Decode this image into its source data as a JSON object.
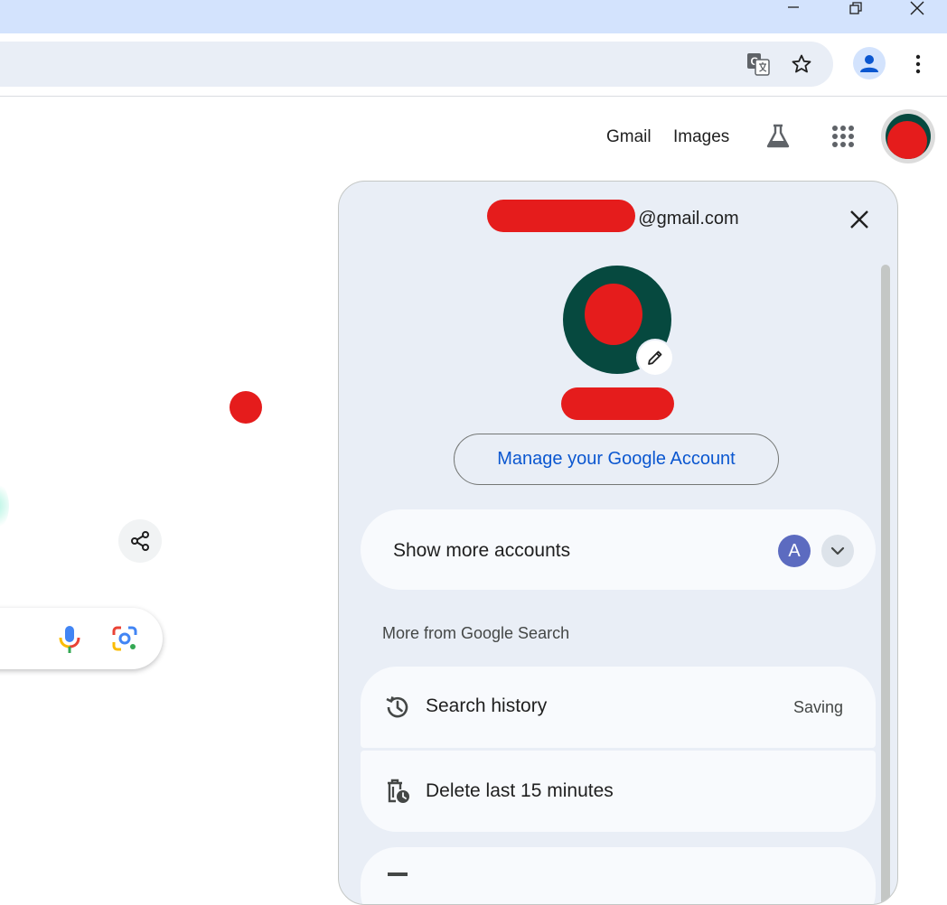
{
  "browser": {
    "window_controls": [
      "minimize",
      "restore",
      "close"
    ],
    "toolbar_icons": [
      "translate-icon",
      "bookmark-star-icon",
      "profile-icon",
      "more-vert-icon"
    ]
  },
  "header": {
    "gmail_label": "Gmail",
    "images_label": "Images"
  },
  "account_panel": {
    "email_suffix": "@gmail.com",
    "manage_button_label": "Manage your Google Account",
    "show_more_accounts_label": "Show more accounts",
    "other_account_initial": "A",
    "section_title": "More from Google Search",
    "rows": [
      {
        "label": "Search history",
        "status": "Saving",
        "icon": "history-icon"
      },
      {
        "label": "Delete last 15 minutes",
        "icon": "delete-clock-icon"
      }
    ]
  },
  "colors": {
    "chrome_titlebar": "#d3e3fd",
    "panel_bg": "#e9eef6",
    "link_blue": "#0b57d0",
    "avatar_green": "#06493f",
    "redaction_red": "#e51c1c",
    "account_a_purple": "#5c6bc0"
  }
}
